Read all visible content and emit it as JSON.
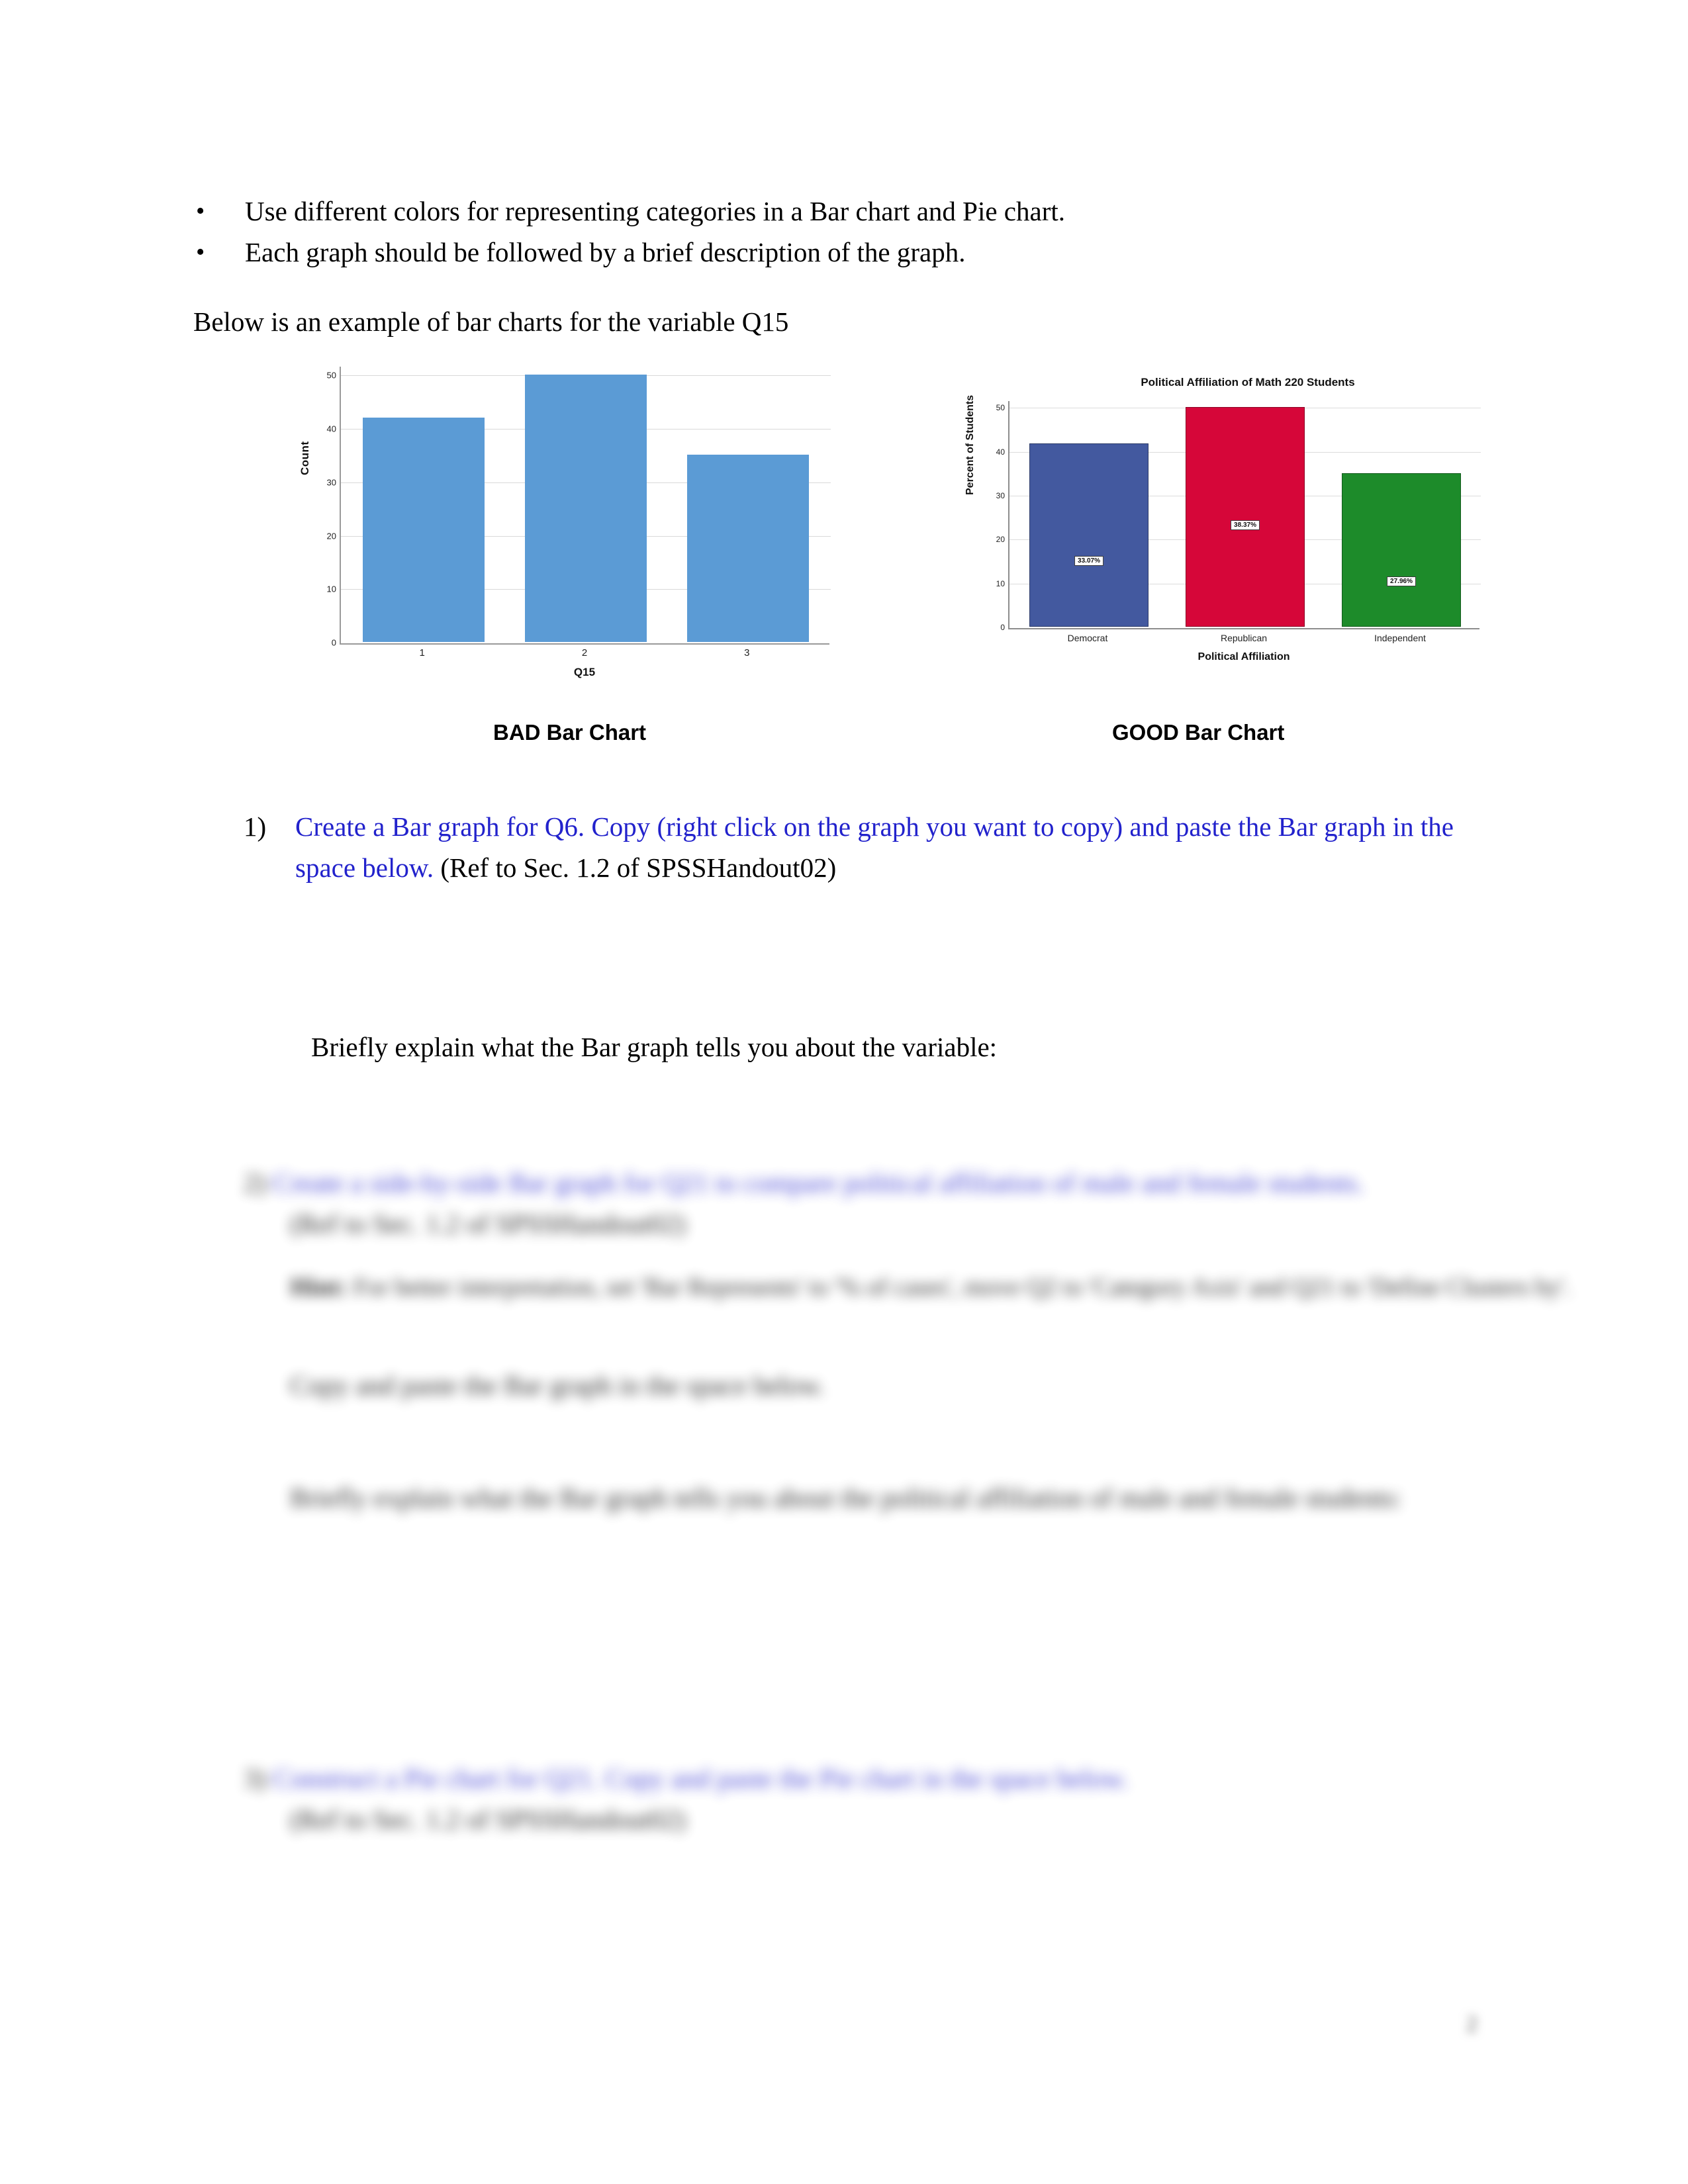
{
  "document": {
    "bullets": [
      "Use different colors for representing categories in a Bar chart and Pie chart.",
      "Each graph should be followed by a brief description of the graph."
    ],
    "intro_line": "Below is an example of bar charts for the variable Q15",
    "caption_bad": "BAD Bar Chart",
    "caption_good": "GOOD Bar Chart",
    "question1": {
      "number": "1)",
      "blue_part": "Create a Bar graph for Q6. Copy (right click on the graph you want to copy) and paste the Bar graph in the space below.",
      "black_part": "(Ref to Sec. 1.2 of SPSSHandout02)"
    },
    "explain_line": "Briefly explain what the Bar graph tells you about the variable:",
    "question2": {
      "number": "2)",
      "blue_part": "Create a side-by-side Bar graph for Q21 to compare political affiliation of male and female students.",
      "black_part": "(Ref to Sec. 1.2 of SPSSHandout02)",
      "note_bold": "Hint:",
      "note_rest": "For better interpretation, set 'Bar Represents' to '% of cases', move Q2 to 'Category Axis' and Q21 to 'Define Clusters by'.",
      "paste_line": "Copy and paste the Bar graph in the space below.",
      "explain_line": "Briefly explain what the Bar graph tells you about the political affiliation of male and female students:"
    },
    "question3": {
      "number": "3)",
      "blue_part": "Construct a Pie chart for Q21. Copy and paste the Pie chart in the space below.",
      "black_part": "(Ref to Sec. 1.2 of SPSSHandout02)"
    },
    "page_number": "2"
  },
  "chart_data": [
    {
      "id": "bad_bar_chart",
      "type": "bar",
      "title": "",
      "caption": "BAD Bar Chart",
      "categories": [
        "1",
        "2",
        "3"
      ],
      "values": [
        42,
        50,
        35
      ],
      "xlabel": "Q15",
      "ylabel": "Count",
      "ylim": [
        0,
        52
      ],
      "yticks": [
        0,
        10,
        20,
        30,
        40,
        50
      ],
      "grid": true,
      "legend": "none",
      "colors": [
        "#5b9bd5",
        "#5b9bd5",
        "#5b9bd5"
      ],
      "single_color": "#5b9bd5",
      "note": "All bars the same color - no data labels - numeric category codes"
    },
    {
      "id": "good_bar_chart",
      "type": "bar",
      "title": "Political Affiliation of Math 220 Students",
      "caption": "GOOD Bar Chart",
      "categories": [
        "Democrat",
        "Republican",
        "Independent"
      ],
      "values": [
        41.8,
        50.0,
        35.0
      ],
      "data_labels": [
        "33.07%",
        "38.37%",
        "27.96%"
      ],
      "xlabel": "Political Affiliation",
      "ylabel": "Percent of Students",
      "ylim": [
        0,
        52
      ],
      "yticks": [
        0,
        10,
        20,
        30,
        40,
        50
      ],
      "grid": true,
      "legend": "none",
      "colors": [
        "#43599f",
        "#d60639",
        "#1d8b2a"
      ],
      "note": "Different color per category, descriptive labels, percentage data labels"
    }
  ]
}
